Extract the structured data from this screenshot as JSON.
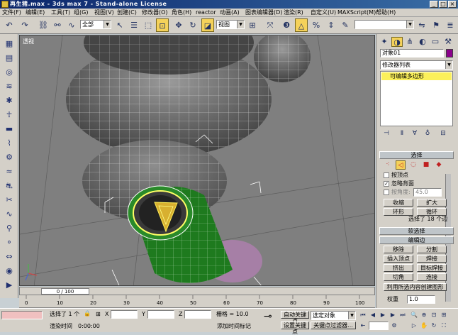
{
  "window": {
    "title": "再生猪.max - 3ds max 7 - Stand-alone License"
  },
  "menu": [
    "文件(F)",
    "编辑(E)",
    "工具(T)",
    "组(G)",
    "视图(V)",
    "创建(C)",
    "修改器(O)",
    "角色(H)",
    "reactor",
    "动画(A)",
    "图表编辑器(D)",
    "渲染(R)",
    "自定义(U)",
    "MAXScript(M)",
    "帮助(H)"
  ],
  "toolbar": {
    "selection_filter": "全部",
    "ref_coord": "视图",
    "named_sel": ""
  },
  "viewport": {
    "label": "透视"
  },
  "timeline": {
    "frame_display": "0 / 100",
    "ticks": [
      "0",
      "10",
      "20",
      "30",
      "40",
      "50",
      "60",
      "70",
      "80",
      "90",
      "100"
    ]
  },
  "command_panel": {
    "object_name": "对象01",
    "object_color": "#8b008b",
    "modifier_list": "修改器列表",
    "stack_item": "可编辑多边形",
    "selection_rollout": "选择",
    "by_vertex": "按顶点",
    "ignore_backfacing": "忽略背面",
    "by_angle": "按角度:",
    "angle_value": "45.0",
    "shrink": "收缩",
    "grow": "扩大",
    "ring": "环形",
    "loop": "循环",
    "selection_info": "选择了 18 个边",
    "soft_selection": "软选择",
    "edit_edges": "编辑边",
    "remove": "移除",
    "split": "分割",
    "insert_vertex": "插入顶点",
    "weld": "焊接",
    "extrude": "挤出",
    "target_weld": "目标焊接",
    "chamfer": "切角",
    "bridge": "连接",
    "create_shape": "利用所选内容创建图形",
    "weight_label": "权重",
    "weight_value": "1.0"
  },
  "status": {
    "selected": "选择了 1 个",
    "x_label": "X",
    "y_label": "Y",
    "z_label": "Z",
    "x_value": "",
    "y_value": "",
    "z_value": "",
    "grid": "栅格 = 10.0",
    "render_time_label": "渲染时间",
    "render_time": "0:00:00",
    "add_time_tag": "添加时间标记",
    "auto_key": "自动关键点",
    "set_key": "设置关键点",
    "selected_object": "选定对象",
    "key_filters": "关键点过滤器..."
  }
}
